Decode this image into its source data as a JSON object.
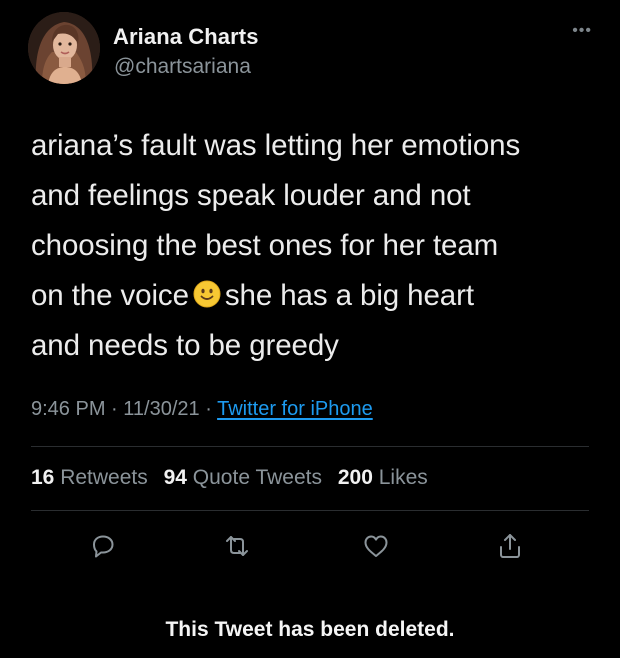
{
  "user": {
    "display_name": "Ariana Charts",
    "handle": "@chartsariana",
    "avatar_icon": "profile-photo"
  },
  "more_icon": "more-options-icon",
  "tweet": {
    "lines": [
      "ariana’s fault was letting her emotions",
      "and feelings speak louder and not",
      "choosing the best ones for her team",
      "on the voice",
      "she has a big heart",
      "and needs to be greedy"
    ],
    "emoji": "slightly-smiling-face"
  },
  "meta": {
    "time": "9:46 PM",
    "date": "11/30/21",
    "separator": "·",
    "source": "Twitter for iPhone"
  },
  "stats": {
    "retweets_count": "16",
    "retweets_label": "Retweets",
    "quotes_count": "94",
    "quotes_label": "Quote Tweets",
    "likes_count": "200",
    "likes_label": "Likes"
  },
  "actions": [
    "reply-icon",
    "retweet-icon",
    "like-icon",
    "share-icon"
  ],
  "notice": "This Tweet has been deleted.",
  "colors": {
    "background": "#000000",
    "text": "#e7e9ea",
    "muted": "#8b949a",
    "link": "#1d9bf0",
    "emoji": "#f7c833"
  }
}
